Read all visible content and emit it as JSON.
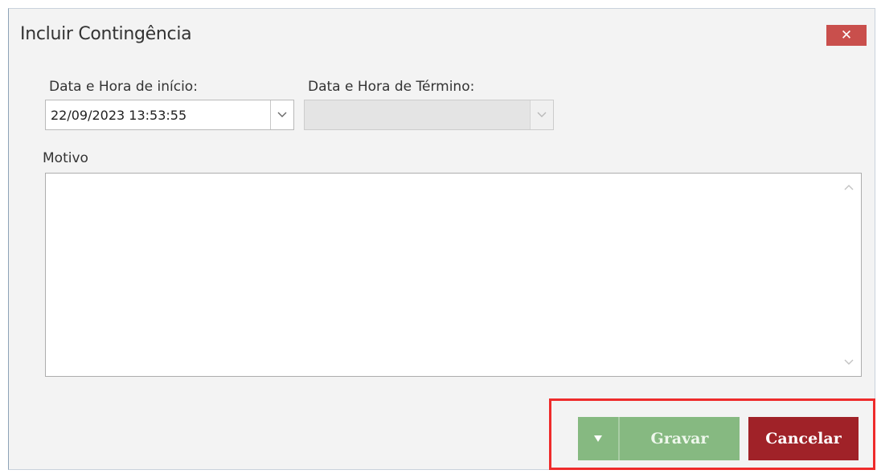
{
  "dialog": {
    "title": "Incluir Contingência",
    "close_label": "✕"
  },
  "start": {
    "label": "Data e Hora de início:",
    "value": "22/09/2023 13:53:55"
  },
  "end": {
    "label": "Data e Hora de Término:",
    "value": ""
  },
  "reason": {
    "label": "Motivo",
    "value": ""
  },
  "actions": {
    "save_label": "Gravar",
    "cancel_label": "Cancelar"
  },
  "icons": {
    "close": "close-icon",
    "dropdown": "chevron-down-icon",
    "split_menu": "triangle-down-icon",
    "scroll_up": "chevron-up-icon",
    "scroll_down": "chevron-down-icon"
  },
  "colors": {
    "save_button": "#86b981",
    "cancel_button": "#a02228",
    "close_button": "#c94f4c",
    "highlight": "#ee2b2b"
  }
}
